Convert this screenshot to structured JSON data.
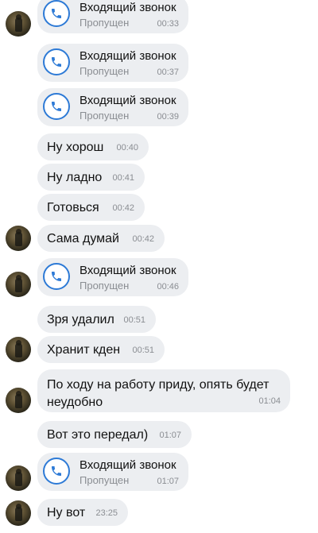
{
  "messages": [
    {
      "type": "call",
      "title": "Входящий звонок",
      "status": "Пропущен",
      "time": "00:33"
    },
    {
      "type": "call",
      "title": "Входящий звонок",
      "status": "Пропущен",
      "time": "00:37"
    },
    {
      "type": "call",
      "title": "Входящий звонок",
      "status": "Пропущен",
      "time": "00:39"
    },
    {
      "type": "text",
      "text": "Ну хорош",
      "time": "00:40"
    },
    {
      "type": "text",
      "text": "Ну ладно",
      "time": "00:41"
    },
    {
      "type": "text",
      "text": "Готовься",
      "time": "00:42"
    },
    {
      "type": "text",
      "text": "Сама думай",
      "time": "00:42"
    },
    {
      "type": "call",
      "title": "Входящий звонок",
      "status": "Пропущен",
      "time": "00:46"
    },
    {
      "type": "text",
      "text": "Зря удалил",
      "time": "00:51"
    },
    {
      "type": "text",
      "text": "Хранит кден",
      "time": "00:51"
    },
    {
      "type": "text",
      "text": "По ходу на работу приду, опять будет неудобно",
      "time": "01:04"
    },
    {
      "type": "text",
      "text": "Вот это передал)",
      "time": "01:07"
    },
    {
      "type": "call",
      "title": "Входящий звонок",
      "status": "Пропущен",
      "time": "01:07"
    },
    {
      "type": "text",
      "text": "Ну вот",
      "time": "23:25"
    }
  ]
}
